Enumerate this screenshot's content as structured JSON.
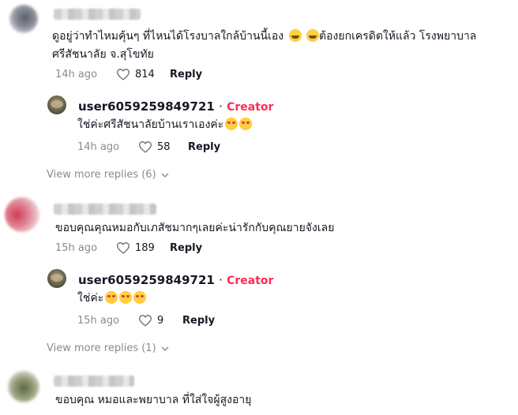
{
  "comments": [
    {
      "text_line1": "ดูอยู่ว่าทำไหมคุ้นๆ ที่ไหนได้โรงบาลใกล้บ้านนี้เอง",
      "text_line1b": "ต้องยกเครดิตให้แล้ว โรงพยาบาล",
      "text_line2": "ศรีสัชนาลัย จ.สุโขทัย",
      "time": "14h ago",
      "likes": "814",
      "reply_label": "Reply",
      "emoji": "rolling-on-floor-laughing",
      "reply": {
        "username": "user6059259849721",
        "separator": "·",
        "badge": "Creator",
        "text": "ใช่ค่ะศรีสัชนาลัยบ้านเราเองค่ะ",
        "emoji": "smiling-face-with-hearts",
        "time": "14h ago",
        "likes": "58",
        "reply_label": "Reply"
      },
      "view_more": "View more replies (6)"
    },
    {
      "text": "ขอบคุณคุณหมอกับเภสัชมากๆเลยค่ะน่ารักกับคุณยายจังเลย",
      "time": "15h ago",
      "likes": "189",
      "reply_label": "Reply",
      "reply": {
        "username": "user6059259849721",
        "separator": "·",
        "badge": "Creator",
        "text": "ใช่ค่ะ",
        "emoji": "smiling-face-with-hearts",
        "time": "15h ago",
        "likes": "9",
        "reply_label": "Reply"
      },
      "view_more": "View more replies (1)"
    },
    {
      "text": "ขอบคุณ หมอและพยาบาล ที่ใส่ใจผู้สูงอายุ"
    }
  ],
  "colors": {
    "creator_badge": "#fe2c55",
    "meta_text": "#8a8b91",
    "text": "#161823"
  }
}
